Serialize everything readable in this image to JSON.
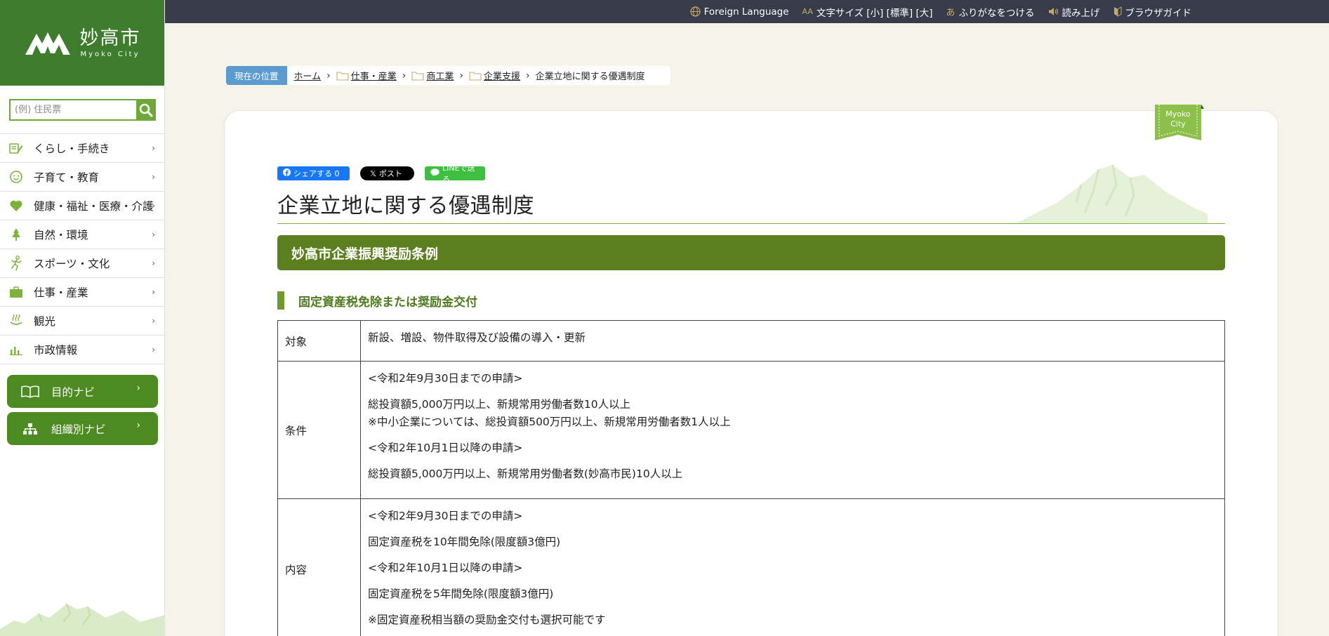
{
  "logo": {
    "name": "妙高市",
    "sub": "Myoko City"
  },
  "search": {
    "placeholder": "(例) 住民票"
  },
  "nav": {
    "items": [
      {
        "label": "くらし・手続き",
        "icon": "pencil-note-icon"
      },
      {
        "label": "子育て・教育",
        "icon": "smile-face-icon"
      },
      {
        "label": "健康・福祉・医療・介護",
        "icon": "heart-icon"
      },
      {
        "label": "自然・環境",
        "icon": "tree-icon"
      },
      {
        "label": "スポーツ・文化",
        "icon": "runner-icon"
      },
      {
        "label": "仕事・産業",
        "icon": "briefcase-icon"
      },
      {
        "label": "観光",
        "icon": "hot-spring-icon"
      },
      {
        "label": "市政情報",
        "icon": "bar-chart-icon"
      }
    ],
    "arrow": "›"
  },
  "navi_buttons": [
    {
      "label": "目的ナビ",
      "icon": "open-book-icon"
    },
    {
      "label": "組織別ナビ",
      "icon": "org-chart-icon"
    }
  ],
  "topbar": {
    "foreign_language": "Foreign Language",
    "font_size": "文字サイズ [小] [標準] [大]",
    "furigana": "ふりがなをつける",
    "read_aloud": "読み上げ",
    "browser_guide": "ブラウザガイド"
  },
  "breadcrumb": {
    "current_tag": "現在の位置",
    "items": [
      "ホーム",
      "仕事・産業",
      "商工業",
      "企業支援"
    ],
    "last": "企業立地に関する優遇制度"
  },
  "ribbon": {
    "line1": "Myoko",
    "line2": "City"
  },
  "share": {
    "facebook": "シェアする 0",
    "x": "ポスト",
    "line": "LINEで送る"
  },
  "page_title": "企業立地に関する優遇制度",
  "section_h2": "妙高市企業振興奨励条例",
  "section_h3": "固定資産税免除または奨励金交付",
  "table": {
    "rows": [
      {
        "header": "対象",
        "lines": [
          "新設、増設、物件取得及び設備の導入・更新"
        ]
      },
      {
        "header": "条件",
        "lines": [
          "<令和2年9月30日までの申請>",
          "総投資額5,000万円以上、新規常用労働者数10人以上",
          "※中小企業については、総投資額500万円以上、新規常用労働者数1人以上",
          "<令和2年10月1日以降の申請>",
          "総投資額5,000万円以上、新規常用労働者数(妙高市民)10人以上"
        ]
      },
      {
        "header": "内容",
        "lines": [
          "<令和2年9月30日までの申請>",
          "固定資産税を10年間免除(限度額3億円)",
          "<令和2年10月1日以降の申請>",
          "固定資産税を5年間免除(限度額3億円)",
          "※固定資産税相当額の奨励金交付も選択可能です"
        ]
      }
    ]
  },
  "colors": {
    "brand_green": "#3f7d2e",
    "heading_green": "#5b7e1f",
    "topbar": "#363c4a",
    "breadcrumb_tag": "#5b9bd0"
  }
}
